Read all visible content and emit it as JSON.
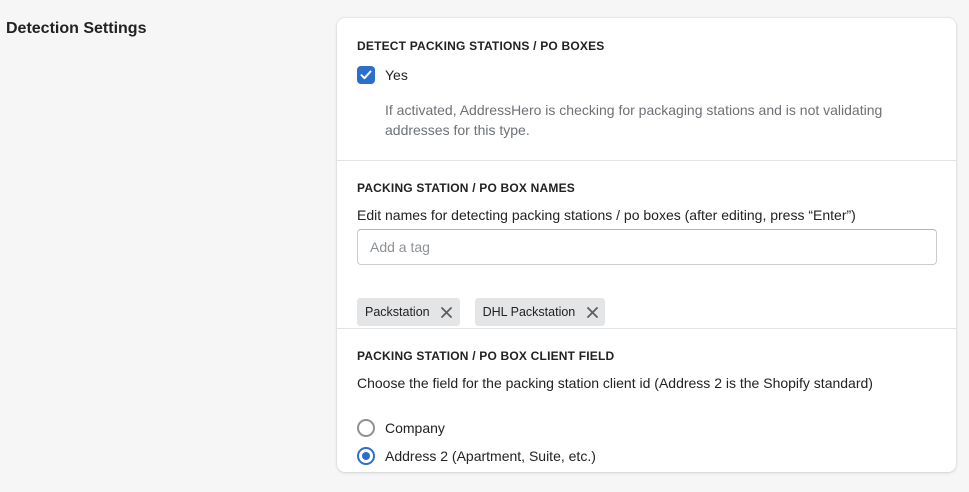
{
  "section_title": "Detection Settings",
  "detect": {
    "heading": "DETECT PACKING STATIONS / PO BOXES",
    "checkbox_label": "Yes",
    "checked": true,
    "help_text": "If activated, AddressHero is checking for packaging stations and is not validating addresses for this type."
  },
  "names": {
    "heading": "PACKING STATION / PO BOX NAMES",
    "description": "Edit names for detecting packing stations / po boxes (after editing, press “Enter”)",
    "input_placeholder": "Add a tag",
    "input_value": "",
    "tags": [
      "Packstation",
      "DHL Packstation"
    ]
  },
  "client_field": {
    "heading": "PACKING STATION / PO BOX CLIENT FIELD",
    "description": "Choose the field for the packing station client id (Address 2 is the Shopify standard)",
    "options": [
      {
        "label": "Company",
        "selected": false
      },
      {
        "label": "Address 2 (Apartment, Suite, etc.)",
        "selected": true
      }
    ]
  },
  "colors": {
    "accent": "#2c6ecb",
    "background": "#f6f6f7",
    "card": "#ffffff",
    "tag_bg": "#e4e5e7",
    "help_text": "#6d7175"
  }
}
